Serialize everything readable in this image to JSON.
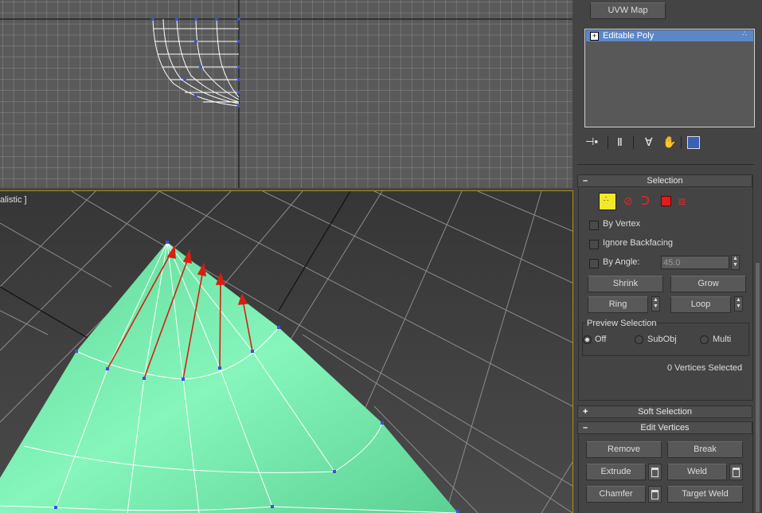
{
  "viewports": {
    "top": {
      "name": "top-viewport"
    },
    "perspective": {
      "label": "alistic ]"
    }
  },
  "modifier_panel": {
    "uvw_button": "UVW Map",
    "stack_items": [
      "Editable Poly"
    ],
    "toolbar_icons": [
      "pin-stack-icon",
      "show-end-result-icon",
      "make-unique-icon",
      "remove-modifier-icon",
      "configure-modifier-sets-icon"
    ]
  },
  "selection": {
    "title": "Selection",
    "title_sign": "–",
    "levels": [
      "vertex-level-icon",
      "edge-level-icon",
      "border-level-icon",
      "polygon-level-icon",
      "element-level-icon"
    ],
    "by_vertex": "By Vertex",
    "ignore_backfacing": "Ignore Backfacing",
    "by_angle": "By Angle:",
    "angle_value": "45.0",
    "shrink": "Shrink",
    "grow": "Grow",
    "ring": "Ring",
    "loop": "Loop",
    "preview_title": "Preview Selection",
    "preview_options": [
      "Off",
      "SubObj",
      "Multi"
    ],
    "preview_selected": "Off",
    "status": "0 Vertices Selected"
  },
  "soft_selection": {
    "title": "Soft Selection",
    "sign": "+"
  },
  "edit_vertices": {
    "title": "Edit Vertices",
    "sign": "–",
    "remove": "Remove",
    "break": "Break",
    "extrude": "Extrude",
    "weld": "Weld",
    "chamfer": "Chamfer",
    "target_weld": "Target Weld"
  },
  "colors": {
    "mesh_green": "#7ef0b0",
    "arrow_red": "#d42010",
    "selected_item": "#5b87c6",
    "active_viewport_border": "#b48c1e"
  }
}
